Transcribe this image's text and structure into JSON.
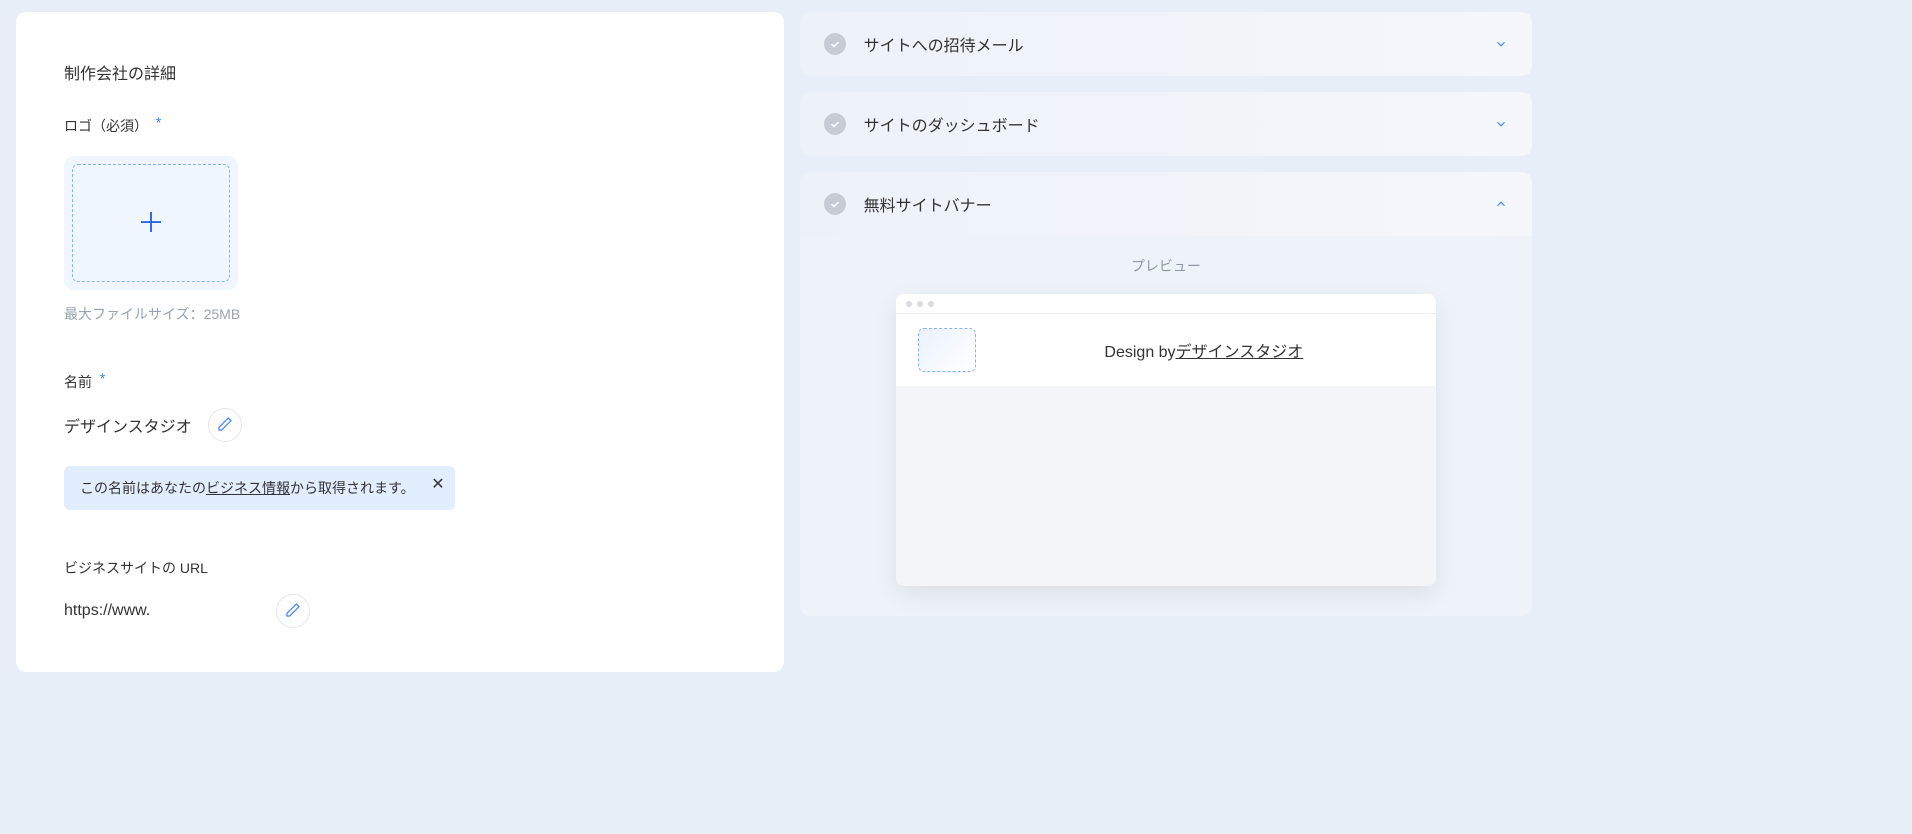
{
  "left": {
    "section_title": "制作会社の詳細",
    "logo_label": "ロゴ（必須）",
    "max_file_size": "最大ファイルサイズ：25MB",
    "name_label": "名前",
    "name_value": "デザインスタジオ",
    "info_prefix": "この名前はあなたの",
    "info_link": "ビジネス情報",
    "info_suffix": "から取得されます。",
    "url_label": "ビジネスサイトの URL",
    "url_value": "https://www."
  },
  "right": {
    "accordions": [
      {
        "title": "サイトへの招待メール"
      },
      {
        "title": "サイトのダッシュボード"
      },
      {
        "title": "無料サイトバナー"
      }
    ],
    "preview_label": "プレビュー",
    "design_by_prefix": "Design by",
    "design_by_studio": "デザインスタジオ"
  }
}
